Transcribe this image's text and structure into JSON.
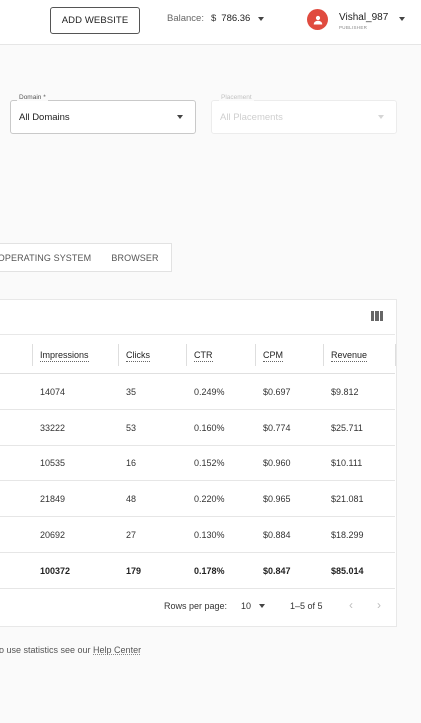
{
  "header": {
    "add_website": "ADD WEBSITE",
    "balance_label": "Balance:",
    "currency": "$",
    "balance_value": "786.36",
    "user_name": "Vishal_987",
    "user_role": "PUBLISHER",
    "avatar_icon": "person-icon",
    "avatar_color": "#e04b3f"
  },
  "filters": {
    "domain": {
      "label": "Domain *",
      "value": "All Domains"
    },
    "placement": {
      "label": "Placement",
      "value": "All Placements"
    }
  },
  "tabs": [
    {
      "label": "OPERATING SYSTEM"
    },
    {
      "label": "BROWSER"
    }
  ],
  "table": {
    "columns_icon": "view-column-icon",
    "columns": [
      "Impressions",
      "Clicks",
      "CTR",
      "CPM",
      "Revenue"
    ],
    "rows": [
      [
        "14074",
        "35",
        "0.249%",
        "$0.697",
        "$9.812"
      ],
      [
        "33222",
        "53",
        "0.160%",
        "$0.774",
        "$25.711"
      ],
      [
        "10535",
        "16",
        "0.152%",
        "$0.960",
        "$10.111"
      ],
      [
        "21849",
        "48",
        "0.220%",
        "$0.965",
        "$21.081"
      ],
      [
        "20692",
        "27",
        "0.130%",
        "$0.884",
        "$18.299"
      ]
    ],
    "total": [
      "100372",
      "179",
      "0.178%",
      "$0.847",
      "$85.014"
    ]
  },
  "pagination": {
    "rows_per_page_label": "Rows per page:",
    "rows_per_page": "10",
    "range": "1–5 of 5",
    "prev_icon": "chevron-left-icon",
    "next_icon": "chevron-right-icon"
  },
  "help": {
    "text_before": "o use statistics see our ",
    "link": "Help Center"
  }
}
